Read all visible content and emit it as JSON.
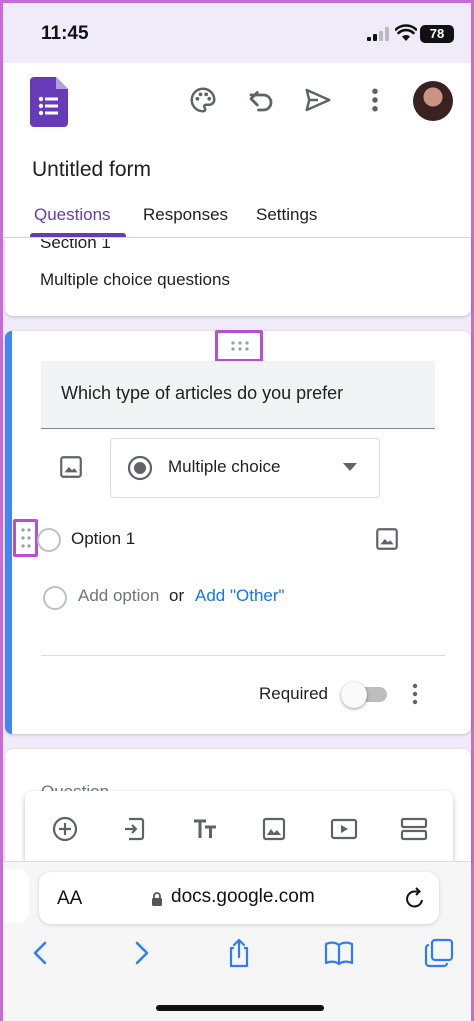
{
  "status_bar": {
    "time": "11:45",
    "battery": "78"
  },
  "header": {
    "form_title": "Untitled form",
    "tabs": [
      {
        "label": "Questions",
        "active": true
      },
      {
        "label": "Responses",
        "active": false
      },
      {
        "label": "Settings",
        "active": false
      }
    ],
    "icons": [
      "forms-logo-icon",
      "palette-icon",
      "undo-icon",
      "send-icon",
      "more-vert-icon",
      "avatar"
    ]
  },
  "section": {
    "title": "Section 1",
    "description": "Multiple choice questions"
  },
  "question": {
    "text": "Which type of articles do you prefer",
    "type": "Multiple choice",
    "options": [
      "Option 1"
    ],
    "add_option": "Add option",
    "or": "or",
    "add_other": "Add \"Other\"",
    "required_label": "Required",
    "required": false
  },
  "next_card": {
    "label": "Question"
  },
  "toolbar": {
    "icons": [
      "add-question-icon",
      "import-questions-icon",
      "add-title-icon",
      "add-image-icon",
      "add-video-icon",
      "add-section-icon"
    ]
  },
  "browser": {
    "aa_label": "AA",
    "url": "docs.google.com"
  },
  "colors": {
    "accent": "#673ab7",
    "background": "#f0ebf8",
    "question_accent": "#4285f4",
    "link": "#1a73e8",
    "highlight_box": "#b64fd0"
  }
}
